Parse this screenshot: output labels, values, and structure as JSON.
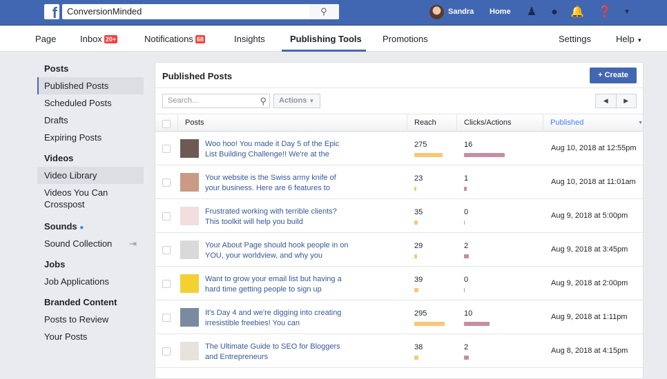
{
  "topbar": {
    "search_value": "ConversionMinded",
    "user": "Sandra",
    "home": "Home"
  },
  "nav": {
    "items": [
      {
        "label": "Page"
      },
      {
        "label": "Inbox",
        "badge": "20+"
      },
      {
        "label": "Notifications",
        "badge": "68"
      },
      {
        "label": "Insights"
      },
      {
        "label": "Publishing Tools"
      },
      {
        "label": "Promotions"
      }
    ],
    "settings": "Settings",
    "help": "Help"
  },
  "sidebar": {
    "posts": {
      "title": "Posts",
      "items": [
        "Published Posts",
        "Scheduled Posts",
        "Drafts",
        "Expiring Posts"
      ]
    },
    "videos": {
      "title": "Videos",
      "items": [
        "Video Library",
        "Videos You Can Crosspost"
      ]
    },
    "sounds": {
      "title": "Sounds",
      "items": [
        "Sound Collection"
      ]
    },
    "jobs": {
      "title": "Jobs",
      "items": [
        "Job Applications"
      ]
    },
    "branded": {
      "title": "Branded Content",
      "items": [
        "Posts to Review",
        "Your Posts"
      ]
    }
  },
  "panel": {
    "title": "Published Posts",
    "create": "+ Create",
    "search_placeholder": "Search...",
    "actions": "Actions",
    "columns": {
      "posts": "Posts",
      "reach": "Reach",
      "clicks": "Clicks/Actions",
      "published": "Published"
    },
    "rows": [
      {
        "text": "Woo hoo! You made it Day 5 of the Epic List Building Challenge!! We're at the",
        "reach": 275,
        "clicks": 16,
        "date": "Aug 10, 2018 at 12:55pm",
        "thumb": "#6d5a55"
      },
      {
        "text": "Your website is the Swiss army knife of your business. Here are 6 features to",
        "reach": 23,
        "clicks": 1,
        "date": "Aug 10, 2018 at 11:01am",
        "thumb": "#c99a85"
      },
      {
        "text": "Frustrated working with terrible clients? This toolkit will help you build",
        "reach": 35,
        "clicks": 0,
        "date": "Aug 9, 2018 at 5:00pm",
        "thumb": "#f2dede"
      },
      {
        "text": "Your About Page should hook people in on YOU, your worldview, and why you",
        "reach": 29,
        "clicks": 2,
        "date": "Aug 9, 2018 at 3:45pm",
        "thumb": "#d9d9d9"
      },
      {
        "text": "Want to grow your email list but having a hard time getting people to sign up",
        "reach": 39,
        "clicks": 0,
        "date": "Aug 9, 2018 at 2:00pm",
        "thumb": "#f5d033"
      },
      {
        "text": "It's Day 4 and we're digging into creating irresistible freebies! You can",
        "reach": 295,
        "clicks": 10,
        "date": "Aug 9, 2018 at 1:11pm",
        "thumb": "#7a8aa0"
      },
      {
        "text": "The Ultimate Guide to SEO for Bloggers and Entrepreneurs",
        "reach": 38,
        "clicks": 2,
        "date": "Aug 8, 2018 at 4:15pm",
        "thumb": "#e8e2dc"
      }
    ]
  },
  "colors": {
    "brand": "#4267b2",
    "reach_bar": "#f7c77a",
    "clicks_bar": "#c58ea4",
    "sort_active": "#4080ff"
  }
}
